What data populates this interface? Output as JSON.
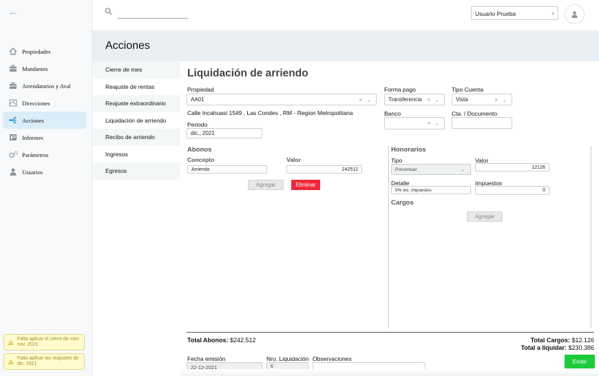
{
  "nav": {
    "items": [
      {
        "label": "Propiedades",
        "icon": "house-icon"
      },
      {
        "label": "Mandantes",
        "icon": "briefcase-icon"
      },
      {
        "label": "Arrendatarios y Aval",
        "icon": "briefcase-icon"
      },
      {
        "label": "Direcciones",
        "icon": "map-icon"
      },
      {
        "label": "Acciones",
        "icon": "share-icon"
      },
      {
        "label": "Informes",
        "icon": "report-icon"
      },
      {
        "label": "Parámetros",
        "icon": "gears-icon"
      },
      {
        "label": "Usuarios",
        "icon": "user-icon"
      }
    ],
    "active": "Acciones"
  },
  "warnings": [
    {
      "line1": "Falta aplicar el cierre de mes",
      "line2": "nov. 2021"
    },
    {
      "line1": "Falta aplicar los reajustes de",
      "line2": "dic. 2021"
    }
  ],
  "header": {
    "search_value": "",
    "user": "Usuario Prueba"
  },
  "page_title": "Acciones",
  "subnav": [
    "Cierre de mes",
    "Reajuste de rentas",
    "Reajuste extraordinario",
    "Liquidación de arriendo",
    "Recibo de arriendo",
    "Ingresos",
    "Egresos"
  ],
  "form": {
    "title": "Liquidación de arriendo",
    "propiedad_label": "Propiedad",
    "propiedad_value": "AA01",
    "address": "Calle Incahuasi 1549 , Las Condes , RM - Region Metropolitana",
    "periodo_label": "Periodo",
    "periodo_value": "dic., 2021",
    "forma_pago_label": "Forma pago",
    "forma_pago_value": "Transferencia",
    "tipo_cuenta_label": "Tipo Cuenta",
    "tipo_cuenta_value": "Vista",
    "banco_label": "Banco",
    "banco_value": "",
    "cta_label": "Cta. / Documento",
    "cta_value": "",
    "clear_glyph": "×",
    "chevron_glyph": "⌄"
  },
  "abonos": {
    "title": "Abonos",
    "concepto_label": "Concepto",
    "valor_label": "Valor",
    "concepto_value": "Arriendo",
    "valor_value": "242512",
    "add_label": "Agregar",
    "delete_label": "Eliminar"
  },
  "honorarios": {
    "title": "Honorarios",
    "tipo_label": "Tipo",
    "tipo_value": "Porcentual",
    "valor_label": "Valor",
    "valor_value": "12126",
    "detalle_label": "Detalle",
    "detalle_value": "5% inc. impuestos",
    "impuestos_label": "Impuestos",
    "impuestos_value": "0",
    "cargos_title": "Cargos",
    "add_label": "Agregar"
  },
  "totals": {
    "abonos_label": "Total Abonos:",
    "abonos_value": "$242.512",
    "cargos_label": "Total Cargos:",
    "cargos_value": "$12.126",
    "liquidar_label": "Total a liquidar:",
    "liquidar_value": "$230.386"
  },
  "footer": {
    "fecha_label": "Fecha emisión",
    "fecha_value": "22-12-2021",
    "nro_label": "Nro. Liquidación",
    "nro_value": "6",
    "obs_label": "Observaciones",
    "obs_value": "",
    "emit_label": "Emitir"
  },
  "colors": {
    "accent_bg": "#dbeef7",
    "title_band": "#e9eff2",
    "delete": "#f0293a",
    "emit": "#1ecb3a",
    "warning_bg": "#fffbcc"
  }
}
